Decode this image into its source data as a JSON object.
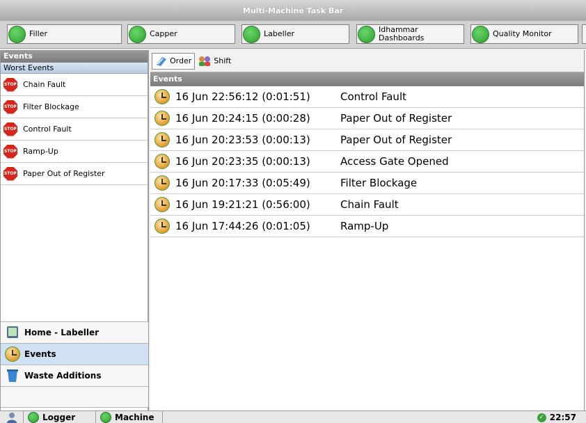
{
  "window": {
    "title": "Multi-Machine Task Bar"
  },
  "machines": [
    {
      "label": "Filler"
    },
    {
      "label": "Capper"
    },
    {
      "label": "Labeller"
    },
    {
      "label_line1": "Idhammar",
      "label_line2": "Dashboards"
    },
    {
      "label": "Quality Monitor"
    }
  ],
  "left_panel": {
    "header": "Events",
    "subheader": "Worst Events",
    "stop_icon_text": "STOP",
    "worst_events": [
      "Chain Fault",
      "Filter Blockage",
      "Control Fault",
      "Ramp-Up",
      "Paper Out of Register"
    ]
  },
  "nav": {
    "home": "Home - Labeller",
    "events": "Events",
    "waste": "Waste Additions"
  },
  "toolbar": {
    "order": "Order",
    "shift": "Shift"
  },
  "events_list": {
    "header": "Events",
    "rows": [
      {
        "time": "16 Jun 22:56:12 (0:01:51)",
        "desc": "Control Fault"
      },
      {
        "time": "16 Jun 20:24:15 (0:00:28)",
        "desc": "Paper Out of Register"
      },
      {
        "time": "16 Jun 20:23:53 (0:00:13)",
        "desc": "Paper Out of Register"
      },
      {
        "time": "16 Jun 20:23:35 (0:00:13)",
        "desc": "Access Gate Opened"
      },
      {
        "time": "16 Jun 20:17:33 (0:05:49)",
        "desc": "Filter Blockage"
      },
      {
        "time": "16 Jun 19:21:21 (0:56:00)",
        "desc": "Chain Fault"
      },
      {
        "time": "16 Jun 17:44:26 (0:01:05)",
        "desc": "Ramp-Up"
      }
    ]
  },
  "statusbar": {
    "logger": "Logger",
    "machine": "Machine",
    "clock": "22:57"
  },
  "colors": {
    "accent_selected": "#cfe1f2",
    "status_green": "#2e9e2e",
    "stop_red": "#d9261c"
  }
}
